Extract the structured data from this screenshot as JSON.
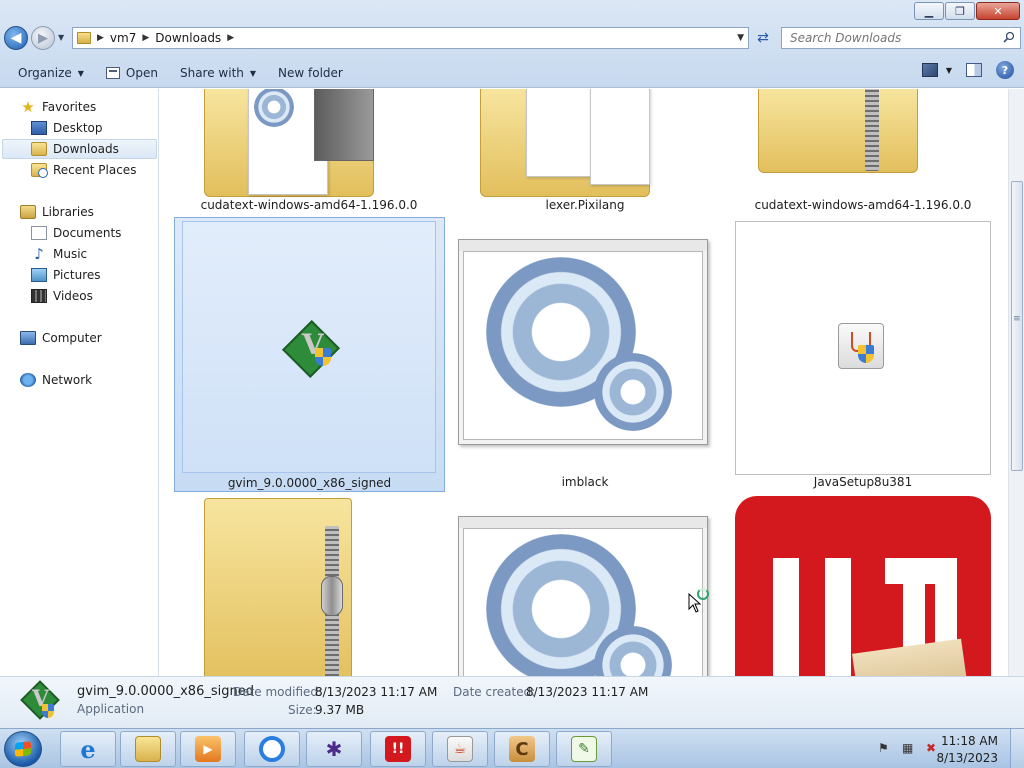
{
  "window": {
    "minimize": "▁",
    "maximize": "❐",
    "close": "✕"
  },
  "address": {
    "crumbs": [
      "vm7",
      "Downloads"
    ],
    "search_placeholder": "Search Downloads"
  },
  "toolbar": {
    "organize": "Organize",
    "open": "Open",
    "share_with": "Share with",
    "new_folder": "New folder"
  },
  "sidebar": {
    "favorites": "Favorites",
    "desktop": "Desktop",
    "downloads": "Downloads",
    "recent_places": "Recent Places",
    "libraries": "Libraries",
    "documents": "Documents",
    "music": "Music",
    "pictures": "Pictures",
    "videos": "Videos",
    "computer": "Computer",
    "network": "Network"
  },
  "files": [
    {
      "name": "cudatext-windows-amd64-1.196.0.0"
    },
    {
      "name": "lexer.Pixilang"
    },
    {
      "name": "cudatext-windows-amd64-1.196.0.0"
    },
    {
      "name": "gvim_9.0.0000_x86_signed"
    },
    {
      "name": "imblack"
    },
    {
      "name": "JavaSetup8u381"
    }
  ],
  "details": {
    "name": "gvim_9.0.0000_x86_signed",
    "type": "Application",
    "date_modified_label": "Date modified:",
    "date_modified": "8/13/2023 11:17 AM",
    "date_created_label": "Date created:",
    "date_created": "8/13/2023 11:17 AM",
    "size_label": "Size:",
    "size": "9.37 MB"
  },
  "taskbar": {
    "time": "11:18 AM",
    "date": "8/13/2023"
  },
  "colors": {
    "selection": "#cfe1f7",
    "accent": "#1f5fb0"
  }
}
